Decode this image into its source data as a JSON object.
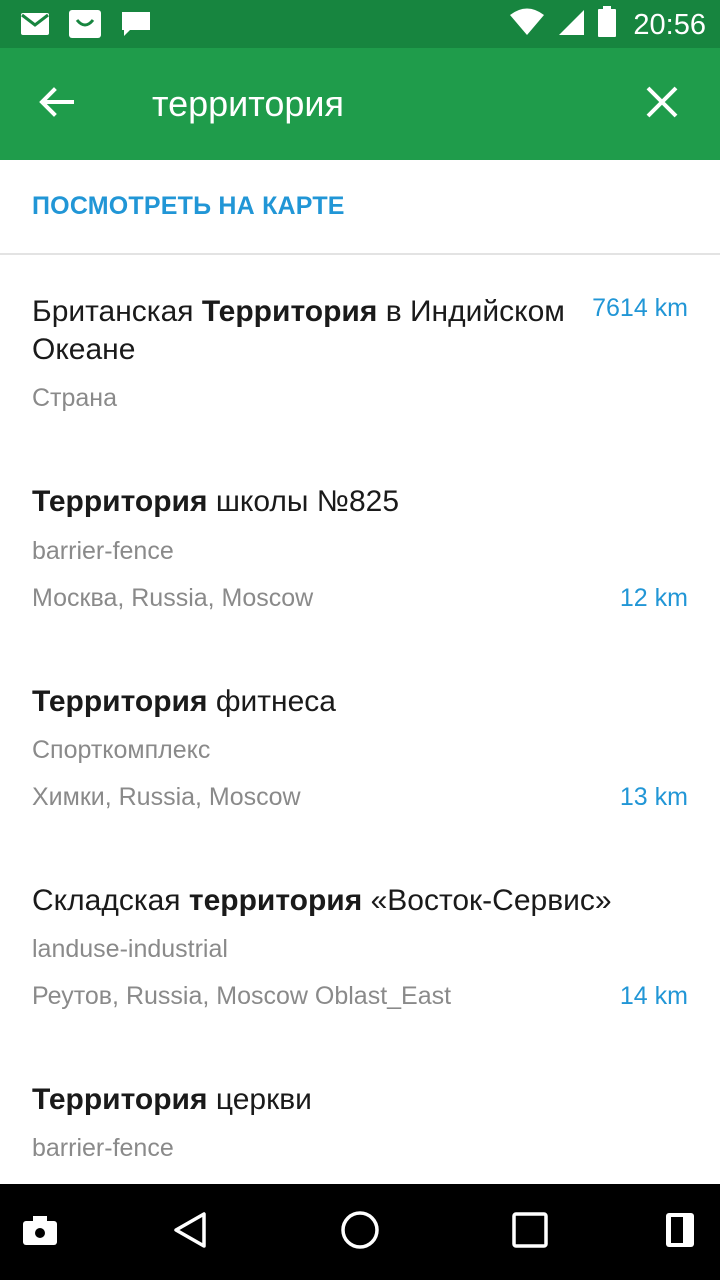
{
  "status_bar": {
    "time": "20:56",
    "icons": [
      "mail-icon",
      "shop-bag-icon",
      "message-icon",
      "wifi-icon",
      "signal-icon",
      "battery-icon"
    ]
  },
  "toolbar": {
    "query": "территория",
    "back_icon": "arrow-back-icon",
    "close_icon": "close-icon"
  },
  "map_link": "ПОСМОТРЕТЬ НА КАРТЕ",
  "results": [
    {
      "title_pre": "Британская ",
      "title_bold": "Территория",
      "title_post": " в Индийском Океане",
      "subtitle": "Страна",
      "location": "",
      "distance": "7614 km"
    },
    {
      "title_pre": "",
      "title_bold": "Территория",
      "title_post": " школы №825",
      "subtitle": "barrier-fence",
      "location": "Москва, Russia, Moscow",
      "distance": "12 km"
    },
    {
      "title_pre": "",
      "title_bold": "Территория",
      "title_post": " фитнеса",
      "subtitle": "Спорткомплекс",
      "location": "Химки, Russia, Moscow",
      "distance": "13 km"
    },
    {
      "title_pre": "Складская ",
      "title_bold": "территория",
      "title_post": " «Восток-Сервис»",
      "subtitle": "landuse-industrial",
      "location": "Реутов, Russia, Moscow Oblast_East",
      "distance": "14 km"
    },
    {
      "title_pre": "",
      "title_bold": "Территория",
      "title_post": " церкви",
      "subtitle": "barrier-fence",
      "location": "",
      "distance": ""
    }
  ],
  "nav_bar": {
    "icons": [
      "screenshot-icon",
      "back-triangle-icon",
      "home-circle-icon",
      "recents-square-icon",
      "screen-icon"
    ]
  },
  "colors": {
    "status_bar": "#17853f",
    "toolbar": "#1f9c4b",
    "accent": "#2196d6"
  }
}
